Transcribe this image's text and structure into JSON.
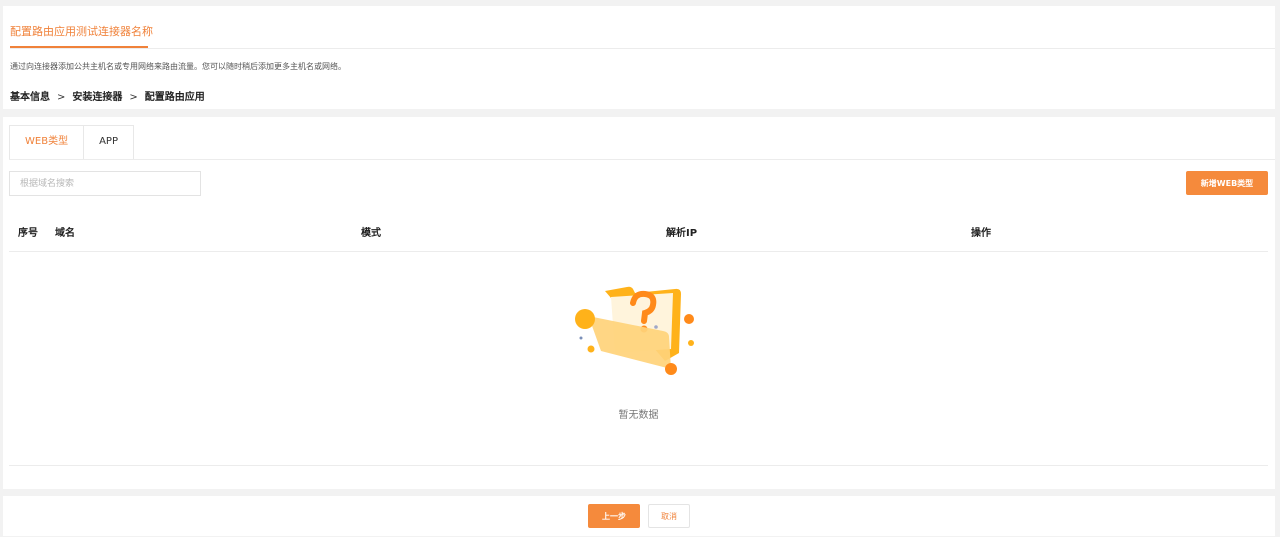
{
  "header": {
    "title": "配置路由应用测试连接器名称",
    "description": "通过向连接器添加公共主机名或专用网络来路由流量。您可以随时稍后添加更多主机名或网络。",
    "breadcrumb": [
      "基本信息",
      "安装连接器",
      "配置路由应用"
    ],
    "breadcrumb_separator": ">"
  },
  "tabs": [
    {
      "label": "WEB类型",
      "active": true
    },
    {
      "label": "APP",
      "active": false
    }
  ],
  "search": {
    "placeholder": "根据域名搜索",
    "value": ""
  },
  "toolbar": {
    "add_label": "新增WEB类型"
  },
  "table": {
    "columns": [
      "序号",
      "域名",
      "模式",
      "解析IP",
      "操作"
    ],
    "rows": [],
    "empty_text": "暂无数据"
  },
  "footer": {
    "prev_label": "上一步",
    "cancel_label": "取消"
  },
  "colors": {
    "accent": "#f58a3c",
    "empty_folder": "#ffb21a"
  }
}
